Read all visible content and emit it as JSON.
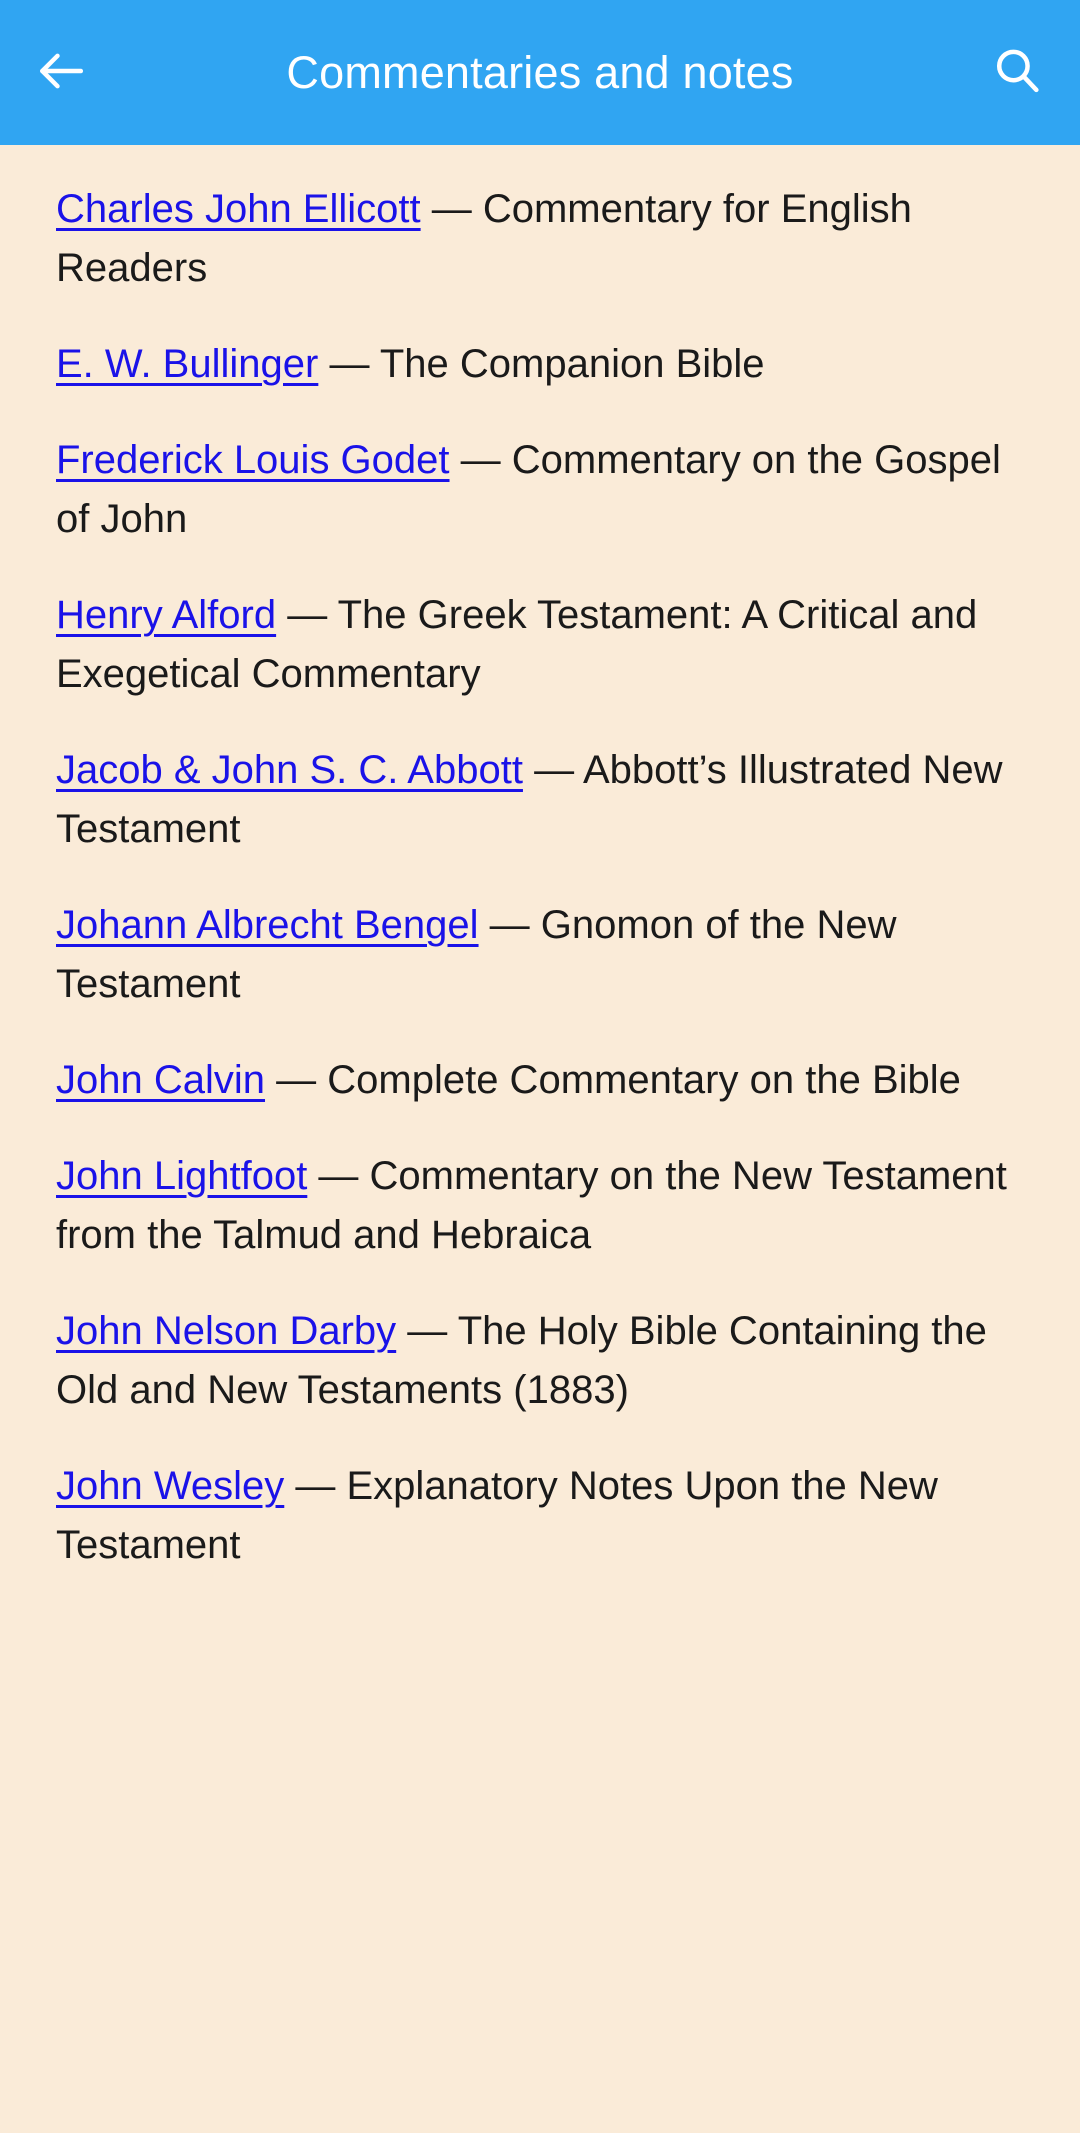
{
  "appbar": {
    "title": "Commentaries and notes",
    "back_icon": "arrow-left-icon",
    "search_icon": "search-icon",
    "background_color": "#30a5f2",
    "text_color": "#ffffff"
  },
  "theme": {
    "page_background": "#faebd8",
    "link_color": "#1a12e8",
    "text_color": "#1a1a1a"
  },
  "separator": "—",
  "list": {
    "items": [
      {
        "author": "Charles John Ellicott",
        "title": "Commentary for English Readers"
      },
      {
        "author": "E. W. Bullinger",
        "title": "The Companion Bible"
      },
      {
        "author": "Frederick Louis Godet",
        "title": "Commentary on the Gospel of John"
      },
      {
        "author": "Henry Alford",
        "title": "The Greek Testament: A Critical and Exegetical Commentary"
      },
      {
        "author": "Jacob & John S. C. Abbott",
        "title": "Abbott’s Illustrated New Testament"
      },
      {
        "author": "Johann Albrecht Bengel",
        "title": "Gnomon of the New Testament"
      },
      {
        "author": "John Calvin",
        "title": "Complete Commentary on the Bible"
      },
      {
        "author": "John Lightfoot",
        "title": "Commentary on the New Testament from the Talmud and Hebraica"
      },
      {
        "author": "John Nelson Darby",
        "title": "The Holy Bible Containing the Old and New Testaments (1883)"
      },
      {
        "author": "John Wesley",
        "title": "Explanatory Notes Upon the New Testament"
      }
    ]
  }
}
